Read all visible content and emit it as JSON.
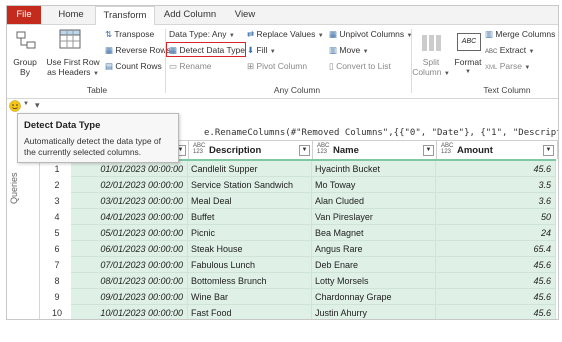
{
  "tabs": [
    {
      "label": "File"
    },
    {
      "label": "Home"
    },
    {
      "label": "Transform"
    },
    {
      "label": "Add Column"
    },
    {
      "label": "View"
    }
  ],
  "ribbon": {
    "table_group": {
      "group_by": "Group\nBy",
      "group_by_l1": "Group",
      "group_by_l2": "By",
      "use_first_row_l1": "Use First Row",
      "use_first_row_l2": "as Headers",
      "transpose": "Transpose",
      "reverse_rows": "Reverse Rows",
      "count_rows": "Count Rows",
      "label": "Table"
    },
    "any_column_group": {
      "data_type": "Data Type: Any",
      "detect_data_type": "Detect Data Type",
      "rename": "Rename",
      "replace_values": "Replace Values",
      "fill": "Fill",
      "pivot_column": "Pivot Column",
      "unpivot_columns": "Unpivot Columns",
      "move": "Move",
      "convert_to_list": "Convert to List",
      "label": "Any Column"
    },
    "text_column_group": {
      "split_column_l1": "Split",
      "split_column_l2": "Column",
      "format": "Format",
      "merge_columns": "Merge Columns",
      "extract": "Extract",
      "parse": "Parse",
      "label": "Text Column",
      "abc_badge": "ABC"
    }
  },
  "formula": {
    "text": "e.RenameColumns(#\"Removed Columns\",{{\"0\", \"Date\"}, {\"1\", \"Description\"}, {\"2\","
  },
  "tooltip": {
    "title": "Detect Data Type",
    "body": "Automatically detect the data type of the currently selected columns."
  },
  "side": {
    "queries_label": "Queries"
  },
  "table": {
    "columns": [
      {
        "type_top": "ABC",
        "type_bottom": "123",
        "name": "Description"
      },
      {
        "type_top": "ABC",
        "type_bottom": "123",
        "name": "Name"
      },
      {
        "type_top": "ABC",
        "type_bottom": "123",
        "name": "Amount"
      }
    ],
    "rows": [
      {
        "n": "1",
        "date": "01/01/2023 00:00:00",
        "desc": "Candlelit Supper",
        "name": "Hyacinth Bucket",
        "amount": "45.6"
      },
      {
        "n": "2",
        "date": "02/01/2023 00:00:00",
        "desc": "Service Station Sandwich",
        "name": "Mo Toway",
        "amount": "3.5"
      },
      {
        "n": "3",
        "date": "03/01/2023 00:00:00",
        "desc": "Meal Deal",
        "name": "Alan Cluded",
        "amount": "3.6"
      },
      {
        "n": "4",
        "date": "04/01/2023 00:00:00",
        "desc": "Buffet",
        "name": "Van Pireslayer",
        "amount": "50"
      },
      {
        "n": "5",
        "date": "05/01/2023 00:00:00",
        "desc": "Picnic",
        "name": "Bea Magnet",
        "amount": "24"
      },
      {
        "n": "6",
        "date": "06/01/2023 00:00:00",
        "desc": "Steak House",
        "name": "Angus Rare",
        "amount": "65.4"
      },
      {
        "n": "7",
        "date": "07/01/2023 00:00:00",
        "desc": "Fabulous Lunch",
        "name": "Deb Enare",
        "amount": "45.6"
      },
      {
        "n": "8",
        "date": "08/01/2023 00:00:00",
        "desc": "Bottomless Brunch",
        "name": "Lotty Morsels",
        "amount": "45.6"
      },
      {
        "n": "9",
        "date": "09/01/2023 00:00:00",
        "desc": "Wine Bar",
        "name": "Chardonnay Grape",
        "amount": "45.6"
      },
      {
        "n": "10",
        "date": "10/01/2023 00:00:00",
        "desc": "Fast Food",
        "name": "Justin Ahurry",
        "amount": "45.6"
      }
    ]
  },
  "colors": {
    "file_tab": "#c42b1c",
    "highlight": "#d9242a",
    "selected_cell": "#dff0e6",
    "header_bar": "#7ec8a4"
  },
  "icons": {
    "smiley": "smiley-icon",
    "dropdown": "chevron-down-icon"
  }
}
